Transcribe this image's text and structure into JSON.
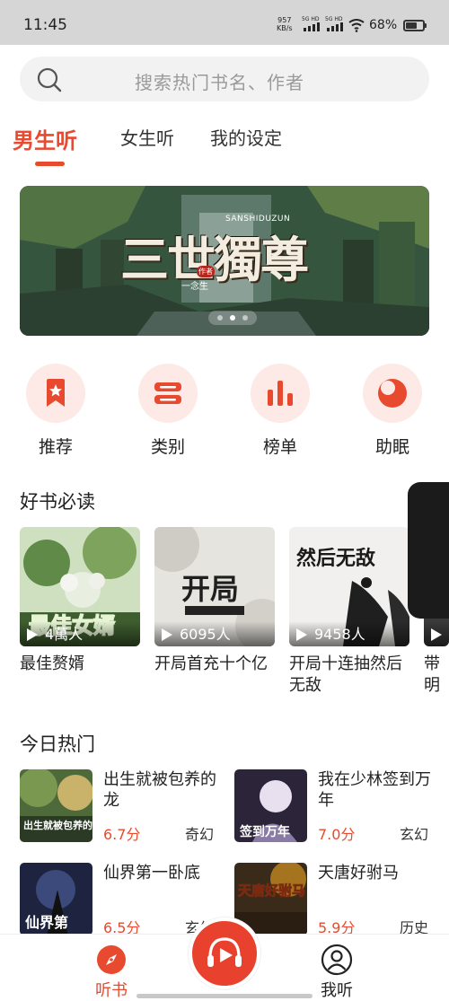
{
  "status_bar": {
    "time": "11:45",
    "net_speed_value": "957",
    "net_speed_unit": "KB/s",
    "sim1_label": "5G HD",
    "sim2_label": "5G HD",
    "battery_percent": "68%",
    "battery_level": 0.68
  },
  "search": {
    "placeholder": "搜索热门书名、作者"
  },
  "tabs": [
    {
      "label": "男生听",
      "active": true
    },
    {
      "label": "女生听",
      "active": false
    },
    {
      "label": "我的设定",
      "active": false
    }
  ],
  "banner": {
    "title": "三世獨尊",
    "pinyin": "SANSHIDUZUN",
    "author_badge": "作者",
    "author": "一念生",
    "slide_count": 3,
    "active_slide": 2
  },
  "categories": [
    {
      "label": "推荐",
      "icon": "bookmark-star-icon"
    },
    {
      "label": "类别",
      "icon": "category-icon"
    },
    {
      "label": "榜单",
      "icon": "ranking-bars-icon"
    },
    {
      "label": "助眠",
      "icon": "moon-icon"
    }
  ],
  "good_books": {
    "title": "好书必读",
    "items": [
      {
        "title": "最佳赘婿",
        "listens": "4萬人",
        "cover_text": "最佳女婿"
      },
      {
        "title": "开局首充十个亿",
        "listens": "6095人",
        "cover_text": "开局"
      },
      {
        "title": "开局十连抽然后无敌",
        "listens": "9458人",
        "cover_text": "然后无敌"
      },
      {
        "title": "带明",
        "listens": "",
        "cover_text": ""
      }
    ]
  },
  "hot_today": {
    "title": "今日热门",
    "items": [
      {
        "title": "出生就被包养的龙",
        "score": "6.7分",
        "genre": "奇幻",
        "cover_text": "出生就被包养的龙"
      },
      {
        "title": "我在少林签到万年",
        "score": "7.0分",
        "genre": "玄幻",
        "cover_text": "签到万年"
      },
      {
        "title": "仙界第一卧底",
        "score": "6.5分",
        "genre": "玄幻",
        "cover_text": "仙界第"
      },
      {
        "title": "天唐好驸马",
        "score": "5.9分",
        "genre": "历史",
        "cover_text": "天唐好驸马"
      }
    ]
  },
  "bottom_nav": {
    "items": [
      {
        "label": "听书",
        "icon": "compass-icon",
        "active": true
      },
      {
        "label": "我听",
        "icon": "profile-icon",
        "active": false
      }
    ],
    "player_icon": "headphones-play-icon"
  },
  "colors": {
    "accent": "#e84a2f",
    "icon_bg": "#fde9e6"
  }
}
